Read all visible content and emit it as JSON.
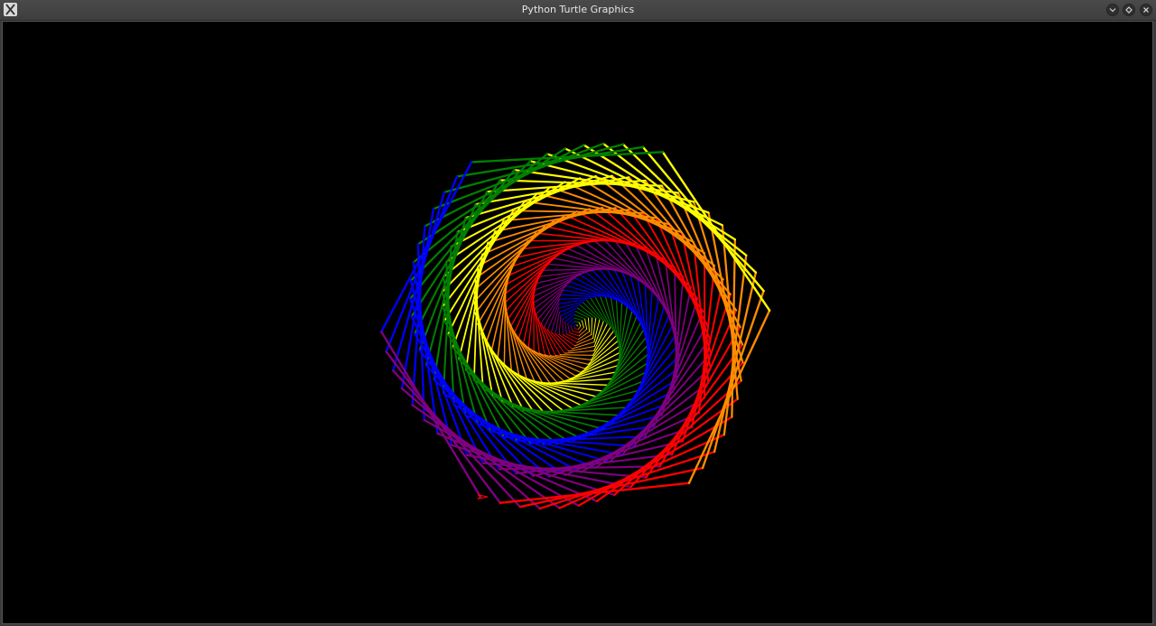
{
  "window": {
    "title": "Python Turtle Graphics",
    "app_icon": "x-window-icon",
    "buttons": [
      {
        "name": "minimize-button",
        "icon": "chevron-down-icon"
      },
      {
        "name": "maximize-button",
        "icon": "diamond-icon"
      },
      {
        "name": "close-button",
        "icon": "close-icon"
      }
    ]
  },
  "canvas": {
    "background": "#000000",
    "drawing": {
      "shape": "spiral-of-hexagons",
      "color_cycle": [
        "#ff0000",
        "#ff8c00",
        "#ffff00",
        "#008000",
        "#0000ff",
        "#800080"
      ]
    }
  }
}
